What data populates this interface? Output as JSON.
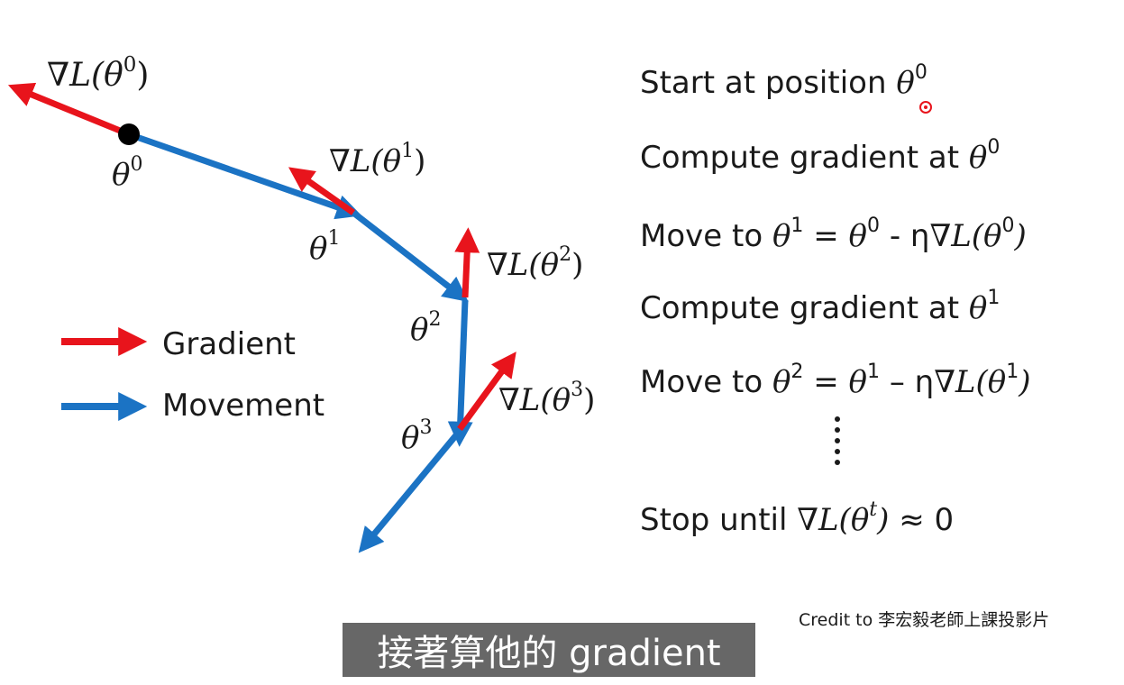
{
  "diagram": {
    "theta_labels": [
      {
        "base": "θ",
        "sup": "0"
      },
      {
        "base": "θ",
        "sup": "1"
      },
      {
        "base": "θ",
        "sup": "2"
      },
      {
        "base": "θ",
        "sup": "3"
      }
    ],
    "gradient_labels": [
      {
        "prefix": "∇L(θ",
        "sup": "0",
        "suffix": ")"
      },
      {
        "prefix": "∇L(θ",
        "sup": "1",
        "suffix": ")"
      },
      {
        "prefix": "∇L(θ",
        "sup": "2",
        "suffix": ")"
      },
      {
        "prefix": "∇L(θ",
        "sup": "3",
        "suffix": ")"
      }
    ],
    "colors": {
      "gradient": "#e8141c",
      "movement": "#1b73c4",
      "point": "#000000"
    }
  },
  "legend": {
    "gradient_label": "Gradient",
    "movement_label": "Movement"
  },
  "steps": {
    "s1": {
      "text": "Start at position ",
      "var": "θ",
      "sup": "0"
    },
    "s2": {
      "text": "Compute gradient at ",
      "var": "θ",
      "sup": "0"
    },
    "s3": {
      "a": "Move to ",
      "v1": "θ",
      "s1": "1",
      "eq": " = ",
      "v2": "θ",
      "s2": "0",
      "op": " - η",
      "grad": "∇L(θ",
      "s3": "0",
      "close": ")"
    },
    "s4": {
      "text": "Compute gradient at ",
      "var": "θ",
      "sup": "1"
    },
    "s5": {
      "a": "Move to ",
      "v1": "θ",
      "s1": "2",
      "eq": " = ",
      "v2": "θ",
      "s2": "1",
      "op": " – η",
      "grad": "∇L(θ",
      "s3": "1",
      "close": ")"
    },
    "s6": {
      "a": "Stop until ",
      "grad": "∇L(θ",
      "sup": "t",
      "close": ")",
      "tail": " ≈ 0"
    }
  },
  "credit": "Credit to 李宏毅老師上課投影片",
  "subtitle": "接著算他的 gradient"
}
